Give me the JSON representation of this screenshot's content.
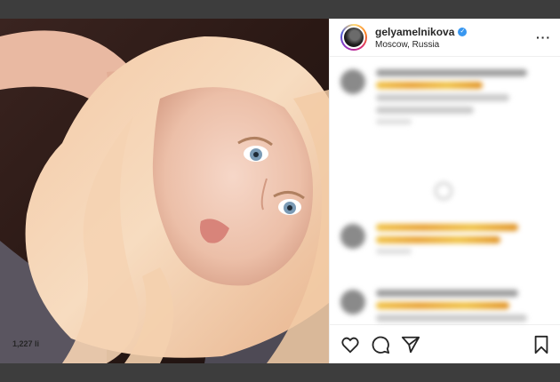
{
  "post": {
    "username": "gelyamelnikova",
    "location": "Moscow, Russia",
    "verified": true,
    "likes_text": "1,227 li"
  },
  "icons": {
    "more": "more-options-icon",
    "like": "heart-icon",
    "comment": "comment-icon",
    "share": "share-icon",
    "save": "bookmark-icon",
    "verified": "verified-badge-icon"
  },
  "colors": {
    "verified": "#3897f0",
    "background": "#3d3d3d"
  }
}
